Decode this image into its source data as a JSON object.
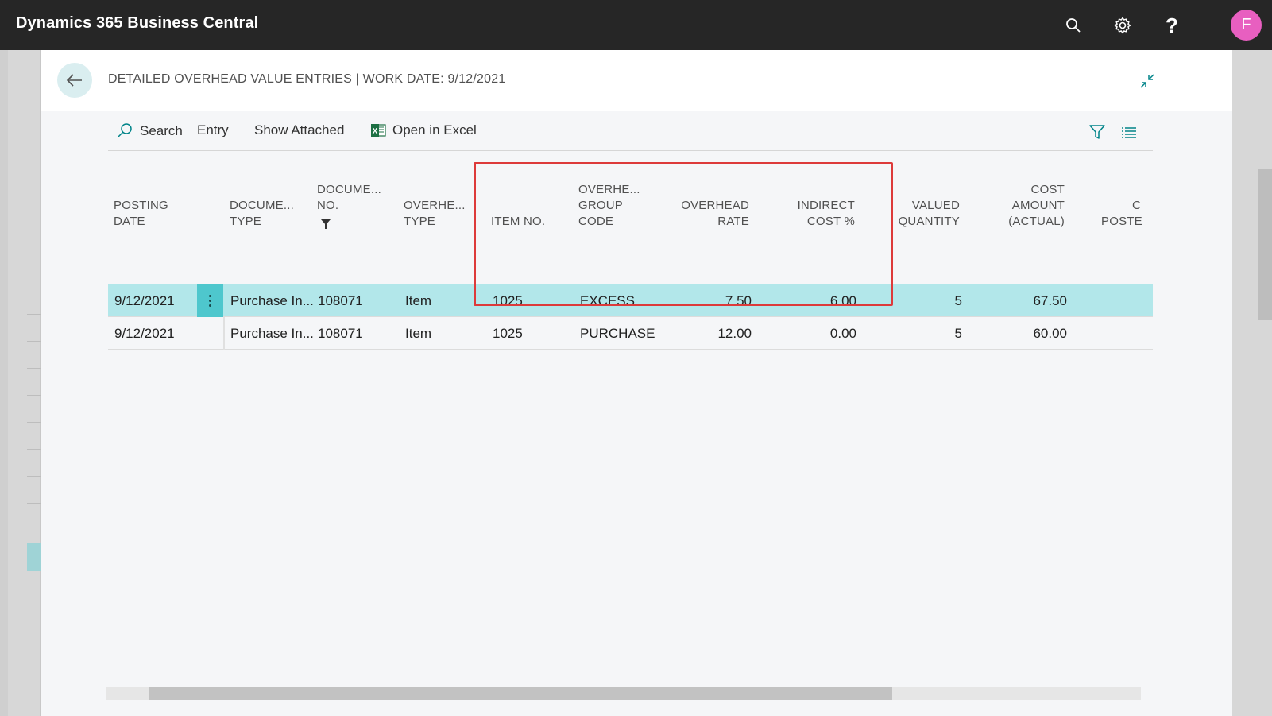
{
  "appbar": {
    "title": "Dynamics 365 Business Central",
    "icons": [
      "search-icon",
      "gear-icon",
      "help-icon"
    ],
    "help_glyph": "?",
    "avatar_initial": "F"
  },
  "dialog": {
    "title": "DETAILED OVERHEAD VALUE ENTRIES | WORK DATE: 9/12/2021"
  },
  "actions": {
    "search_label": "Search",
    "entry_label": "Entry",
    "show_attached_label": "Show Attached",
    "open_in_excel_label": "Open in Excel"
  },
  "grid": {
    "columns": {
      "posting_date": [
        "POSTING",
        "DATE"
      ],
      "document_type": [
        "DOCUME...",
        "TYPE"
      ],
      "document_no": [
        "DOCUME...",
        "NO."
      ],
      "overhead_type": [
        "OVERHE...",
        "TYPE"
      ],
      "item_no": [
        "ITEM NO."
      ],
      "overhead_group_code": [
        "OVERHE...",
        "GROUP",
        "CODE"
      ],
      "overhead_rate": [
        "OVERHEAD",
        "RATE"
      ],
      "indirect_cost_pct": [
        "INDIRECT",
        "COST %"
      ],
      "valued_quantity": [
        "VALUED",
        "QUANTITY"
      ],
      "cost_amount_actual": [
        "COST",
        "AMOUNT",
        "(ACTUAL)"
      ],
      "cost_posted": [
        "C",
        "POSTE"
      ]
    },
    "rows": [
      {
        "posting_date": "9/12/2021",
        "document_type": "Purchase In...",
        "document_no": "108071",
        "overhead_type": "Item",
        "item_no": "1025",
        "overhead_group_code": "EXCESS",
        "overhead_rate": "7.50",
        "indirect_cost_pct": "6.00",
        "valued_quantity": "5",
        "cost_amount_actual": "67.50",
        "selected": true
      },
      {
        "posting_date": "9/12/2021",
        "document_type": "Purchase In...",
        "document_no": "108071",
        "overhead_type": "Item",
        "item_no": "1025",
        "overhead_group_code": "PURCHASE",
        "overhead_rate": "12.00",
        "indirect_cost_pct": "0.00",
        "valued_quantity": "5",
        "cost_amount_actual": "60.00",
        "selected": false
      }
    ]
  },
  "colors": {
    "appbar": "#262626",
    "accent": "#008489",
    "selected_row": "#b2e7ea",
    "row_menu": "#4ec7cd",
    "highlight_border": "#dd3a3a",
    "avatar": "#e85fc0"
  }
}
